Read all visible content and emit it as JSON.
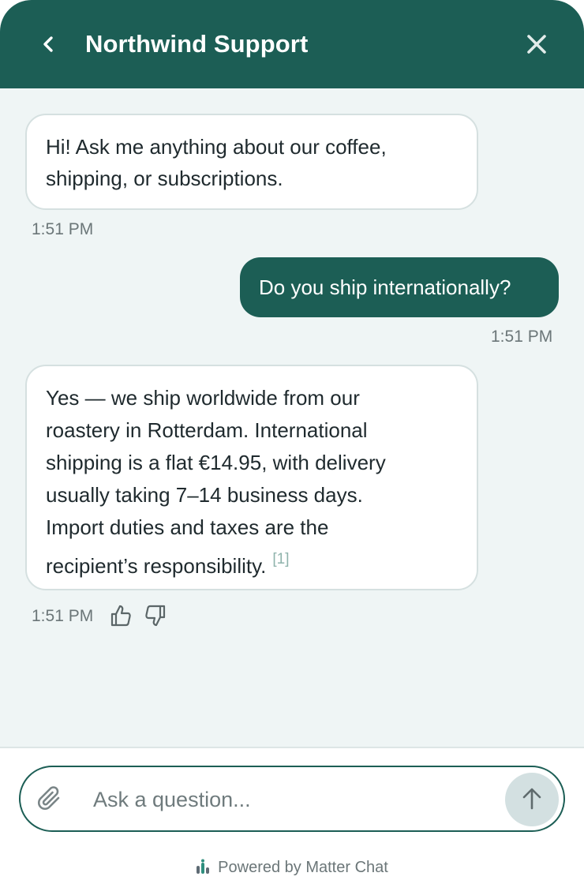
{
  "header": {
    "title": "Northwind Support",
    "back_icon": "chevron-left-icon",
    "close_icon": "close-icon",
    "background_color": "#1c5e55"
  },
  "messages": [
    {
      "role": "bot",
      "lines": [
        "Hi! Ask me anything about our coffee,",
        "shipping, or subscriptions."
      ],
      "time": "1:51 PM"
    },
    {
      "role": "user",
      "text": "Do you ship internationally?",
      "time": "1:51 PM"
    },
    {
      "role": "bot",
      "lines": [
        "Yes — we ship worldwide from our",
        "roastery in Rotterdam. International",
        "shipping is a flat €14.95, with delivery",
        "usually taking 7–14 business days.",
        "Import duties and taxes are the",
        "recipient’s responsibility."
      ],
      "citation": "[1]",
      "time": "1:51 PM",
      "feedback_icons": [
        "thumbs-up-icon",
        "thumbs-down-icon"
      ]
    }
  ],
  "composer": {
    "placeholder": "Ask a question...",
    "value": "",
    "attach_icon": "paperclip-icon",
    "send_icon": "arrow-up-icon"
  },
  "footer": {
    "powered_by": "Powered by Matter Chat"
  },
  "colors": {
    "accent": "#1c5e55",
    "panel_background": "#eff5f5",
    "bot_bubble": "#ffffff",
    "citation": "#8fb3ac"
  }
}
